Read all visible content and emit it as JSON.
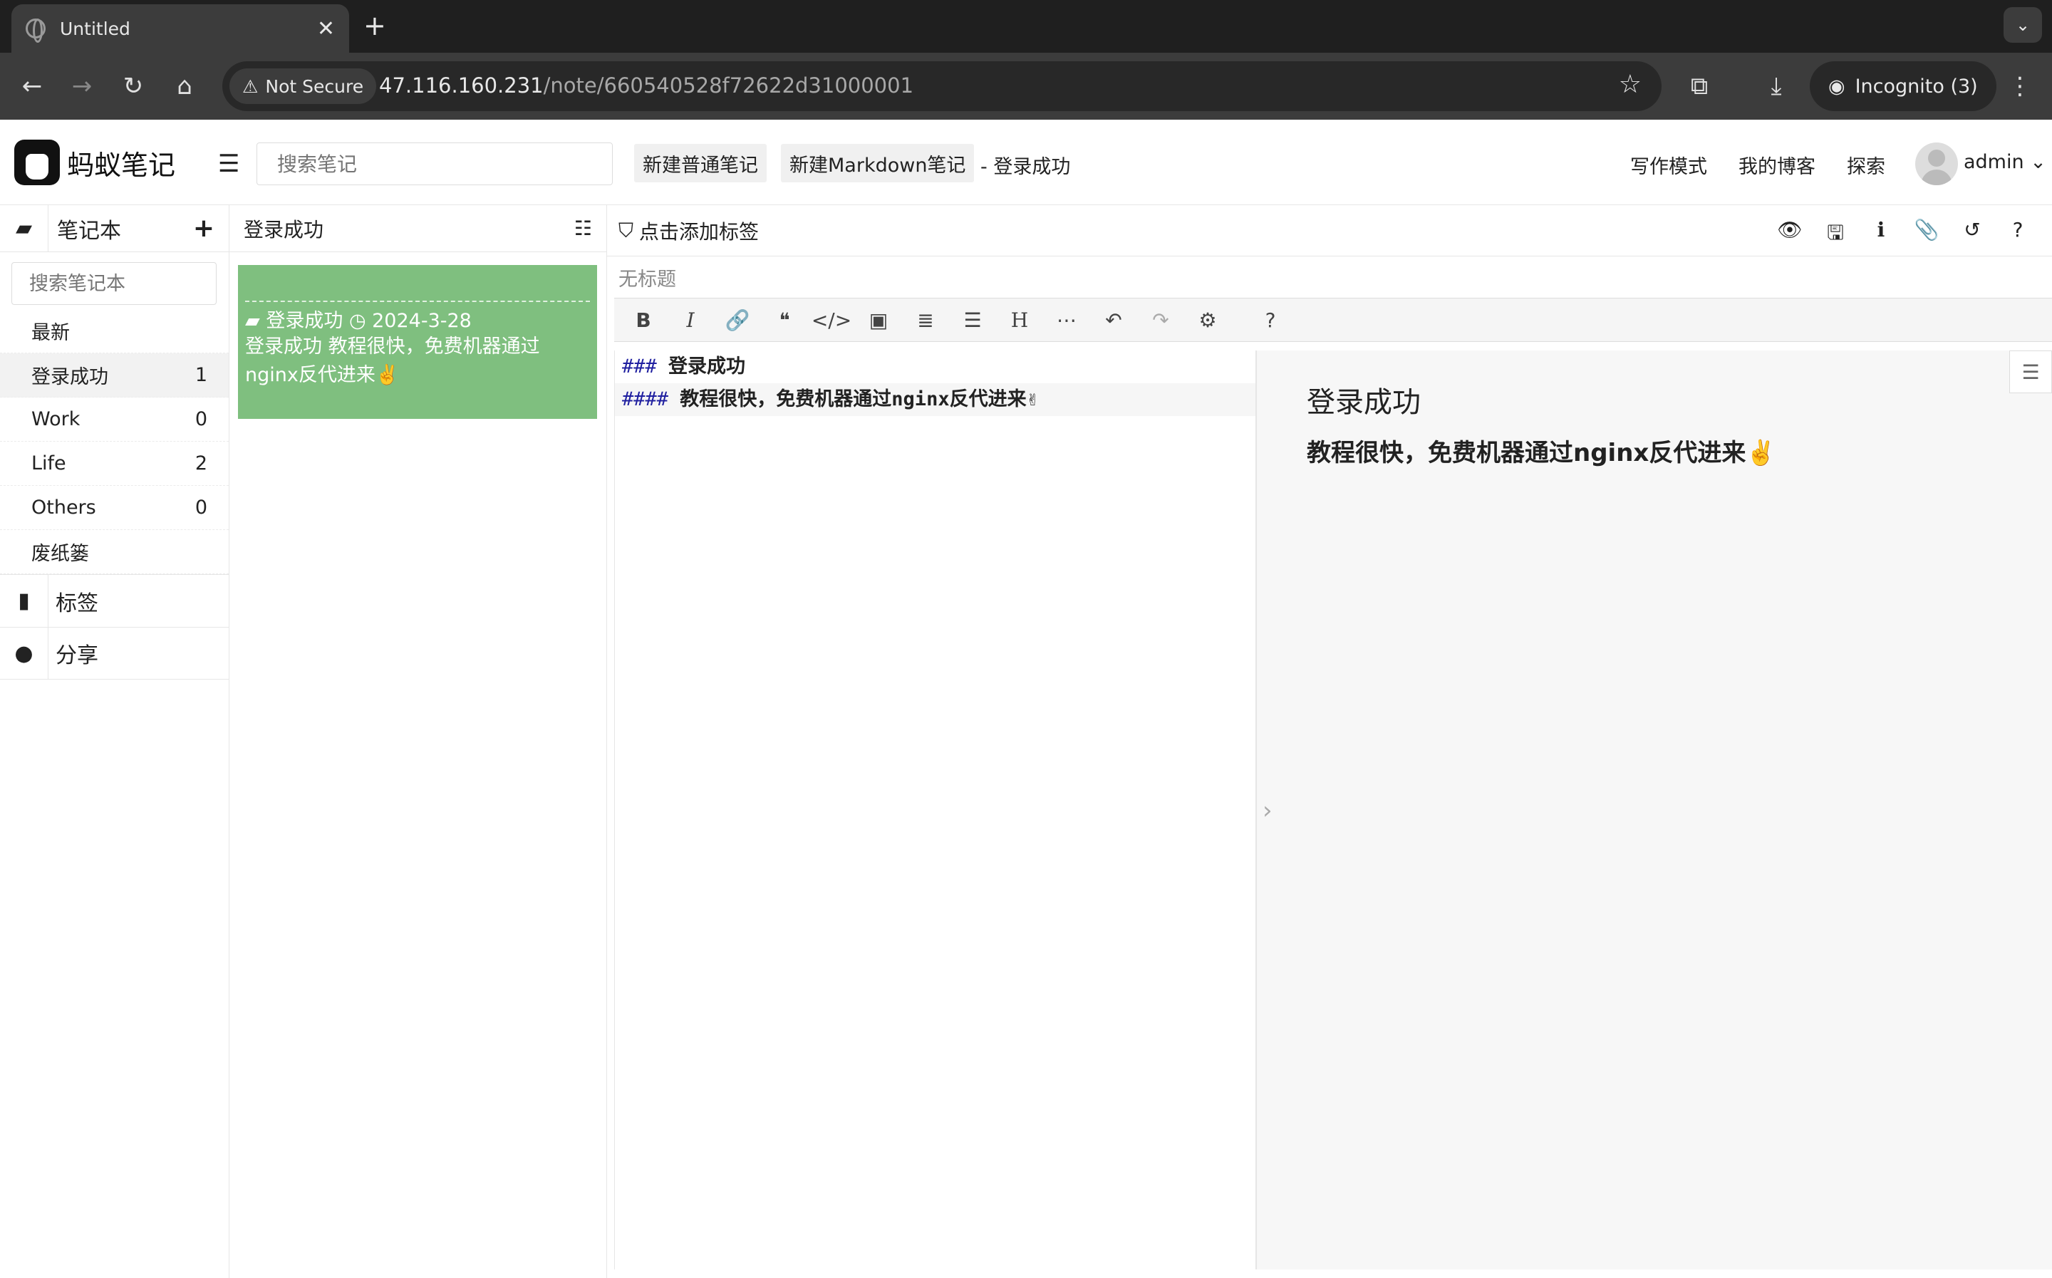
{
  "browser": {
    "tab_title": "Untitled",
    "security": "Not Secure",
    "url_host": "47.116.160.231",
    "url_path": "/note/660540528f72622d31000001",
    "incognito": "Incognito (3)"
  },
  "header": {
    "logo_text": "蚂蚁笔记",
    "search_placeholder": "搜索笔记",
    "new_note": "新建普通笔记",
    "new_markdown": "新建Markdown笔记",
    "current_note": "- 登录成功",
    "links": [
      "写作模式",
      "我的博客",
      "探索"
    ],
    "user": "admin"
  },
  "sidebar": {
    "title": "笔记本",
    "search_placeholder": "搜索笔记本",
    "items": [
      {
        "label": "最新",
        "count": ""
      },
      {
        "label": "登录成功",
        "count": "1"
      },
      {
        "label": "Work",
        "count": "0"
      },
      {
        "label": "Life",
        "count": "2"
      },
      {
        "label": "Others",
        "count": "0"
      },
      {
        "label": "废纸篓",
        "count": ""
      }
    ],
    "tags_label": "标签",
    "share_label": "分享"
  },
  "notelist": {
    "title": "登录成功",
    "card": {
      "notebook": "登录成功",
      "date": "2024-3-28",
      "summary": "登录成功 教程很快，免费机器通过nginx反代进来✌️"
    }
  },
  "editor": {
    "add_tag": "点击添加标签",
    "title_placeholder": "无标题",
    "source_lines": [
      {
        "hash": "###",
        "text": "登录成功"
      },
      {
        "hash": "####",
        "text": "教程很快，免费机器通过nginx反代进来✌"
      }
    ],
    "preview_h3": "登录成功",
    "preview_h4": "教程很快，免费机器通过nginx反代进来✌️"
  }
}
